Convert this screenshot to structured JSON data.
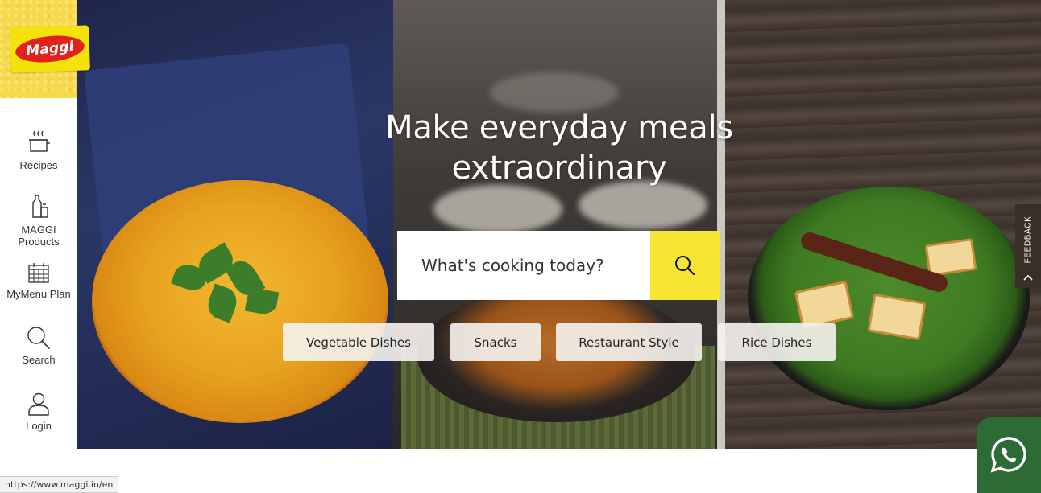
{
  "brand": {
    "logo_text": "Maggi",
    "logo_color": "#e3211a",
    "band_color": "#f7d94c"
  },
  "sidebar": {
    "items": [
      {
        "label": "Recipes",
        "icon": "pot-steam-icon"
      },
      {
        "label": "MAGGI Products",
        "icon": "bottle-icon"
      },
      {
        "label": "MyMenu Plan",
        "icon": "calendar-icon"
      },
      {
        "label": "Search",
        "icon": "search-icon"
      },
      {
        "label": "Login",
        "icon": "user-icon"
      }
    ]
  },
  "hero": {
    "headline_line1": "Make everyday meals",
    "headline_line2": "extraordinary"
  },
  "search": {
    "placeholder": "What's cooking today?",
    "button_color": "#f7e534"
  },
  "categories": [
    "Vegetable Dishes",
    "Snacks",
    "Restaurant Style",
    "Rice Dishes"
  ],
  "feedback": {
    "label": "FEEDBACK"
  },
  "whatsapp": {
    "icon": "whatsapp-icon",
    "color": "#2d6b34"
  },
  "status_bar": {
    "url": "https://www.maggi.in/en"
  }
}
